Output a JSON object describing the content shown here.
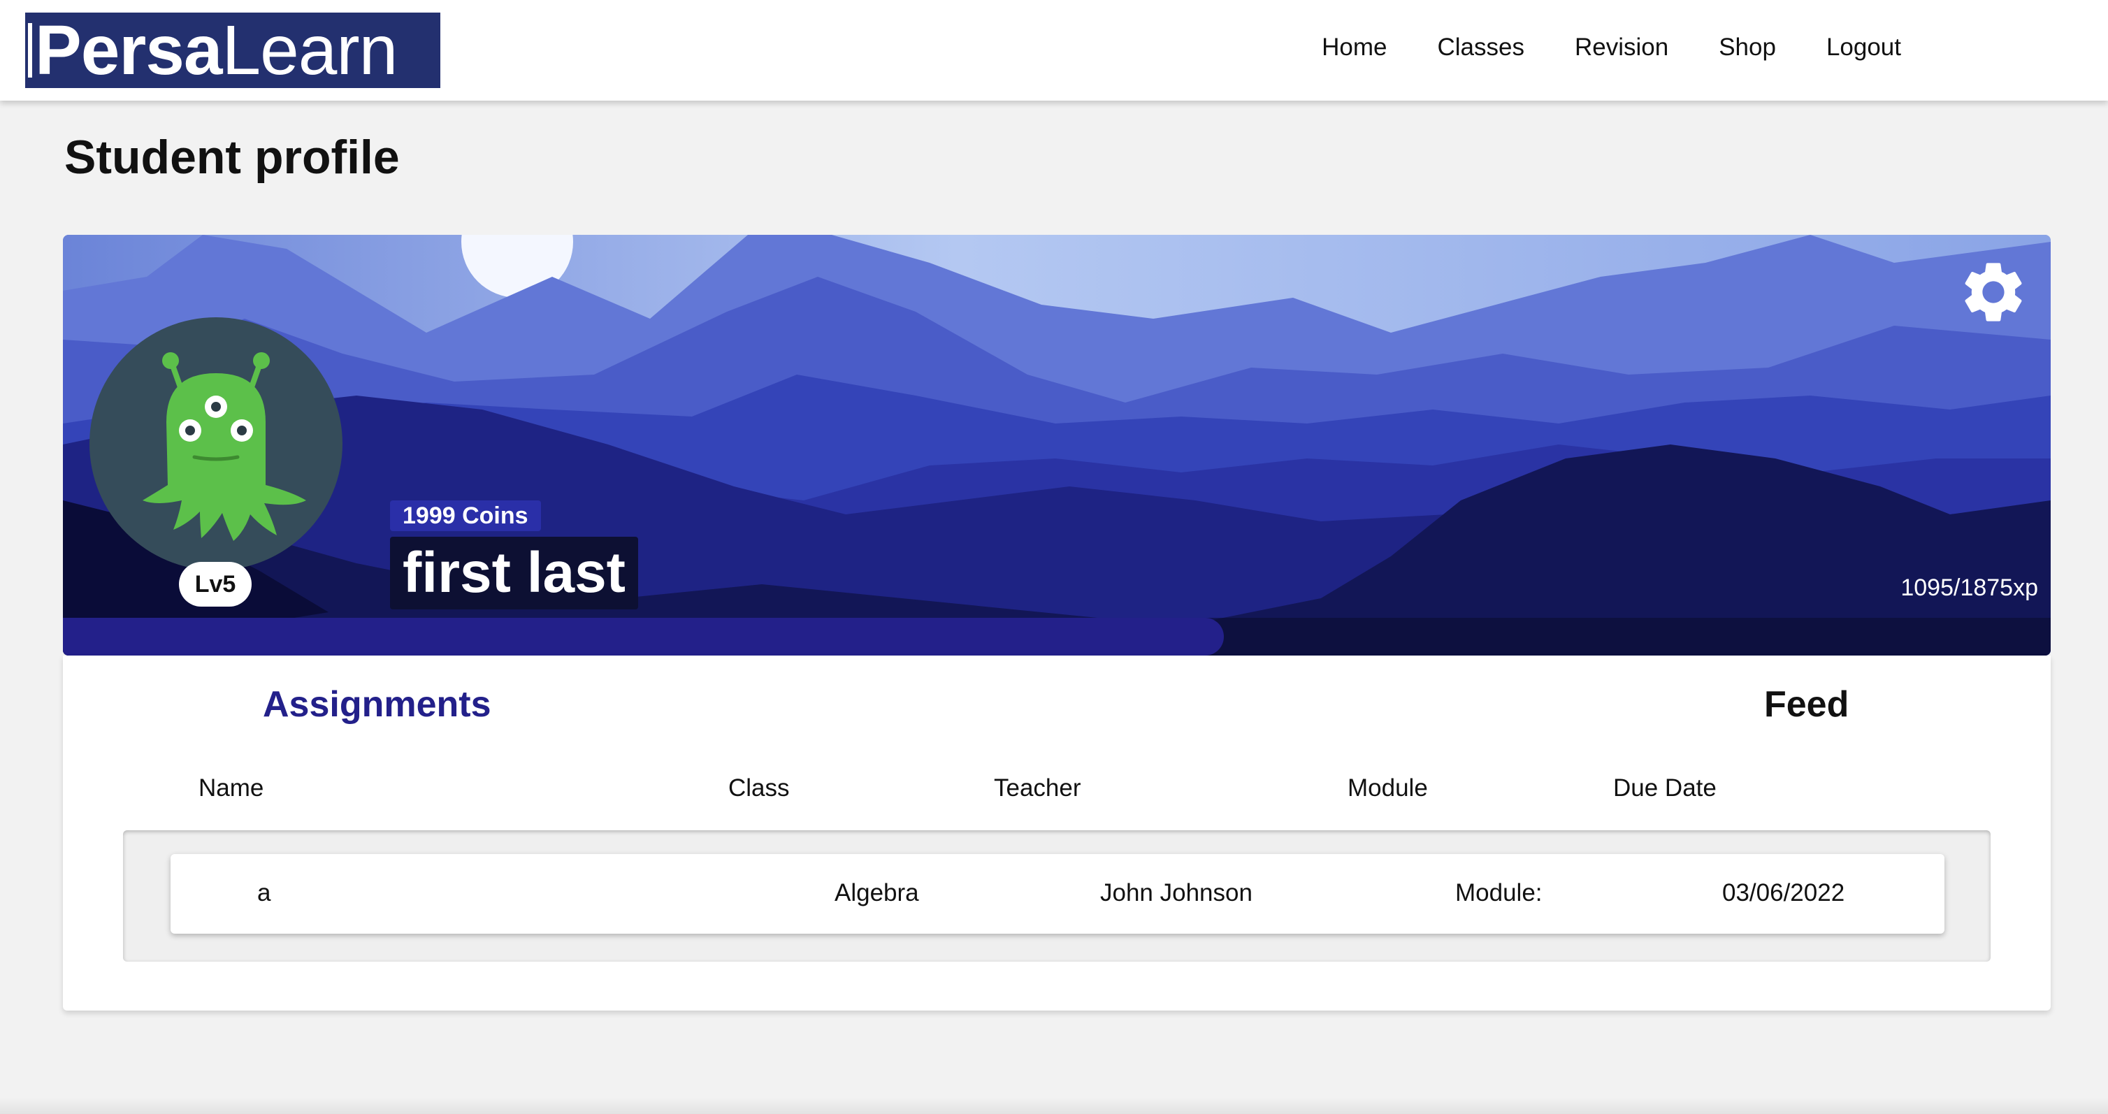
{
  "brand": {
    "logo_bold": "Persa",
    "logo_light": "Learn"
  },
  "nav": {
    "items": [
      {
        "label": "Home"
      },
      {
        "label": "Classes"
      },
      {
        "label": "Revision"
      },
      {
        "label": "Shop"
      },
      {
        "label": "Logout"
      }
    ]
  },
  "page": {
    "title": "Student profile"
  },
  "profile": {
    "coins": "1999 Coins",
    "name": "first last",
    "level": "Lv5",
    "xp": "1095/1875xp",
    "xp_fraction": 0.584,
    "avatar_icon": "green-alien-icon",
    "settings_icon": "gear-icon"
  },
  "tabs": {
    "assignments": "Assignments",
    "feed": "Feed"
  },
  "table": {
    "headers": {
      "name": "Name",
      "class": "Class",
      "teacher": "Teacher",
      "module": "Module",
      "due": "Due Date"
    },
    "rows": [
      {
        "name": "a",
        "class": "Algebra",
        "teacher": "John Johnson",
        "module": "Module:",
        "due": "03/06/2022"
      }
    ]
  },
  "colors": {
    "accent": "#23208a",
    "logo_bg": "#23306f",
    "coins_bg": "#2a2fa8",
    "name_bg": "#0d1033",
    "avatar_bg": "#354c5a",
    "alien": "#5cc04a"
  }
}
